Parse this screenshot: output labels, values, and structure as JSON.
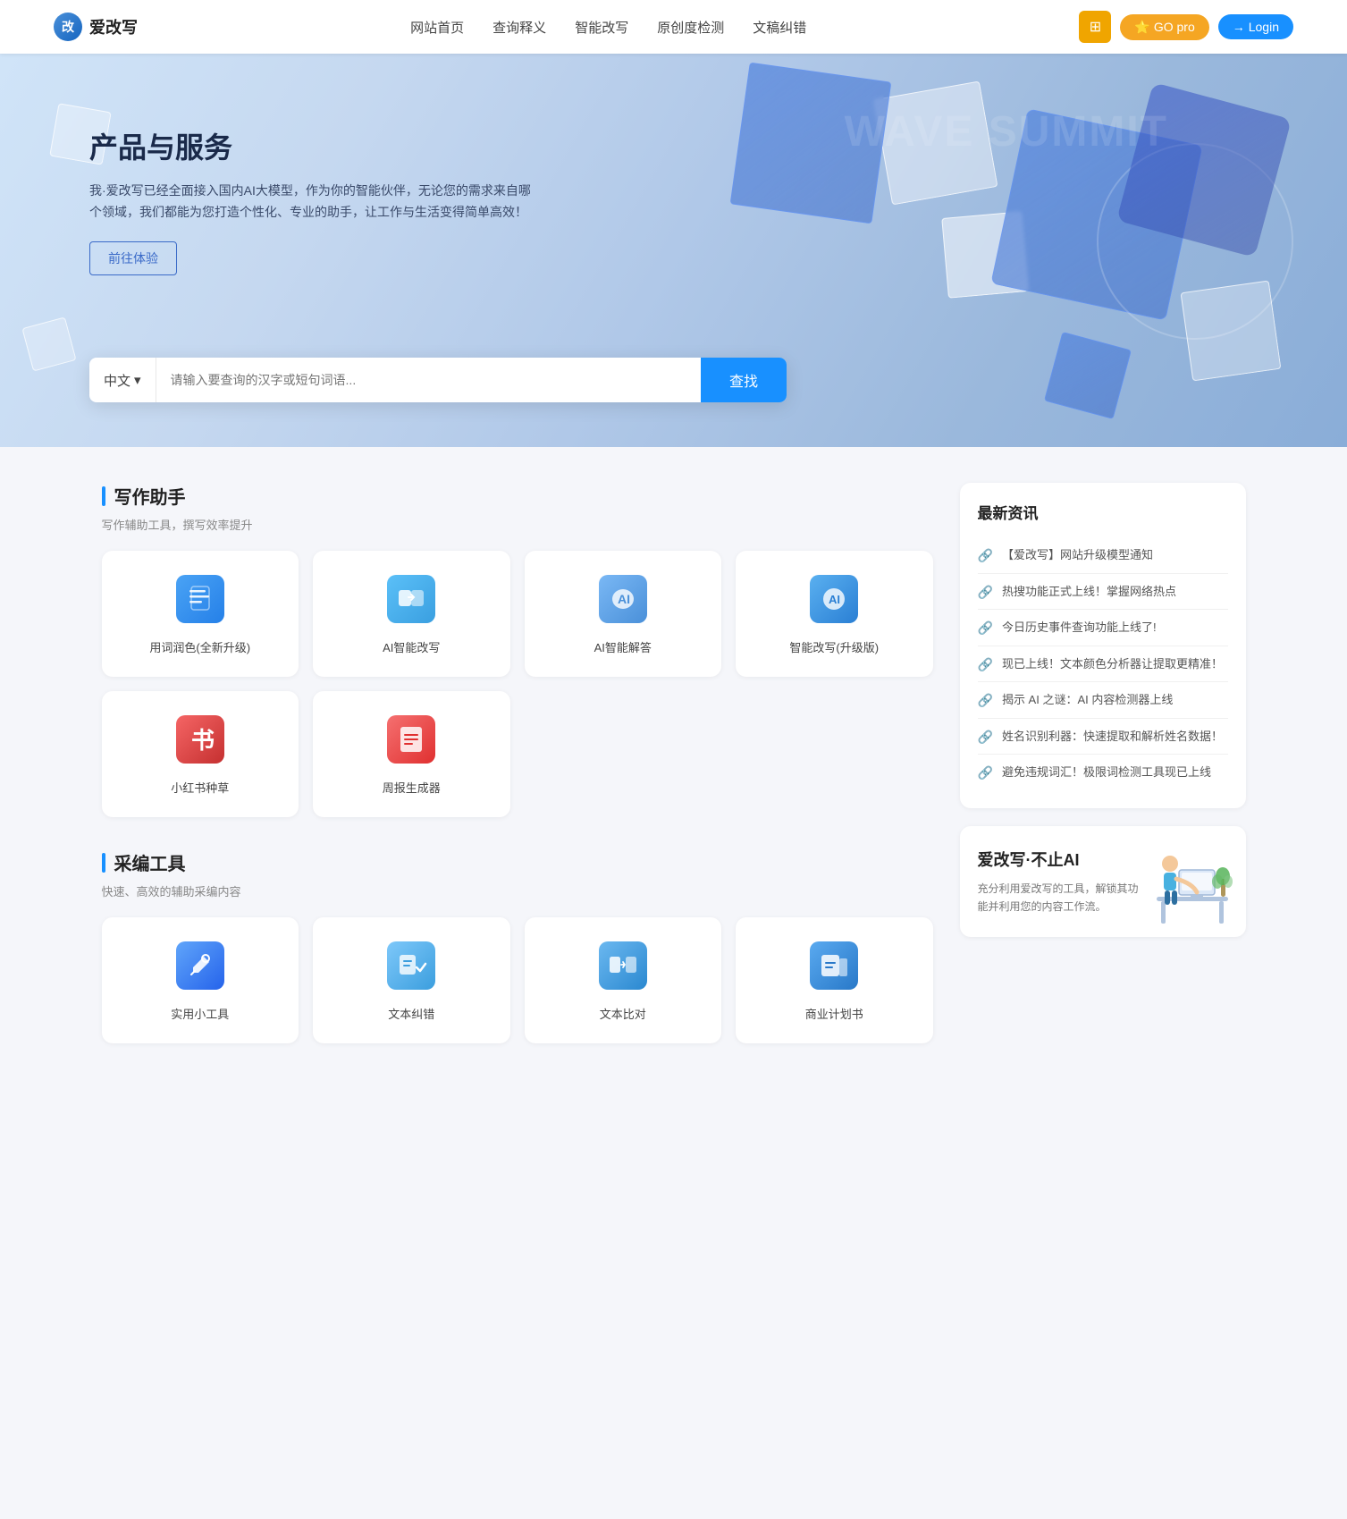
{
  "header": {
    "logo_icon": "改",
    "logo_text": "爱改写",
    "nav": [
      {
        "label": "网站首页",
        "id": "nav-home"
      },
      {
        "label": "查询释义",
        "id": "nav-lookup"
      },
      {
        "label": "智能改写",
        "id": "nav-rewrite"
      },
      {
        "label": "原创度检测",
        "id": "nav-check"
      },
      {
        "label": "文稿纠错",
        "id": "nav-proofread"
      }
    ],
    "btn_grid_icon": "⊞",
    "btn_go_pro": "GO pro",
    "btn_login": "Login"
  },
  "hero": {
    "title": "产品与服务",
    "subtitle": "我·爱改写已经全面接入国内AI大模型，作为你的智能伙伴，无论您的需求来自哪个领域，我们都能为您打造个性化、专业的助手，让工作与生活变得简单高效！",
    "btn_try": "前往体验",
    "search_lang": "中文",
    "search_placeholder": "请输入要查询的汉字或短句词语...",
    "search_btn": "查找"
  },
  "writing_section": {
    "title": "写作助手",
    "subtitle": "写作辅助工具，撰写效率提升",
    "tools": [
      {
        "label": "用词润色(全新升级)",
        "icon_type": "writing",
        "icon_char": "📄"
      },
      {
        "label": "AI智能改写",
        "icon_type": "ai-rewrite",
        "icon_char": "↺"
      },
      {
        "label": "AI智能解答",
        "icon_type": "ai-answer",
        "icon_char": "💬"
      },
      {
        "label": "智能改写(升级版)",
        "icon_type": "smart-rewrite",
        "icon_char": "✦"
      },
      {
        "label": "小红书种草",
        "icon_type": "xiaohongshu",
        "icon_char": "书"
      },
      {
        "label": "周报生成器",
        "icon_type": "weekly",
        "icon_char": "📋"
      }
    ]
  },
  "caipian_section": {
    "title": "采编工具",
    "subtitle": "快速、高效的辅助采编内容",
    "tools": [
      {
        "label": "实用小工具",
        "icon_type": "tools",
        "icon_char": "🔧"
      },
      {
        "label": "文本纠错",
        "icon_type": "text-check",
        "icon_char": "✓"
      },
      {
        "label": "文本比对",
        "icon_type": "text-compare",
        "icon_char": "⇄"
      },
      {
        "label": "商业计划书",
        "icon_type": "business",
        "icon_char": "📊"
      }
    ]
  },
  "news": {
    "title": "最新资讯",
    "items": [
      {
        "text": "【爱改写】网站升级模型通知"
      },
      {
        "text": "热搜功能正式上线！掌握网络热点"
      },
      {
        "text": "今日历史事件查询功能上线了!"
      },
      {
        "text": "现已上线！文本颜色分析器让提取更精准！"
      },
      {
        "text": "揭示 AI 之谜：AI 内容检测器上线"
      },
      {
        "text": "姓名识别利器：快速提取和解析姓名数据！"
      },
      {
        "text": "避免违规词汇！极限词检测工具现已上线"
      }
    ]
  },
  "promo": {
    "title": "爱改写·不止AI",
    "subtitle": "充分利用爱改写的工具，解锁其功能并利用您的内容工作流。"
  },
  "colors": {
    "accent_blue": "#1890ff",
    "accent_orange": "#f5a623",
    "red": "#e53e3e"
  }
}
